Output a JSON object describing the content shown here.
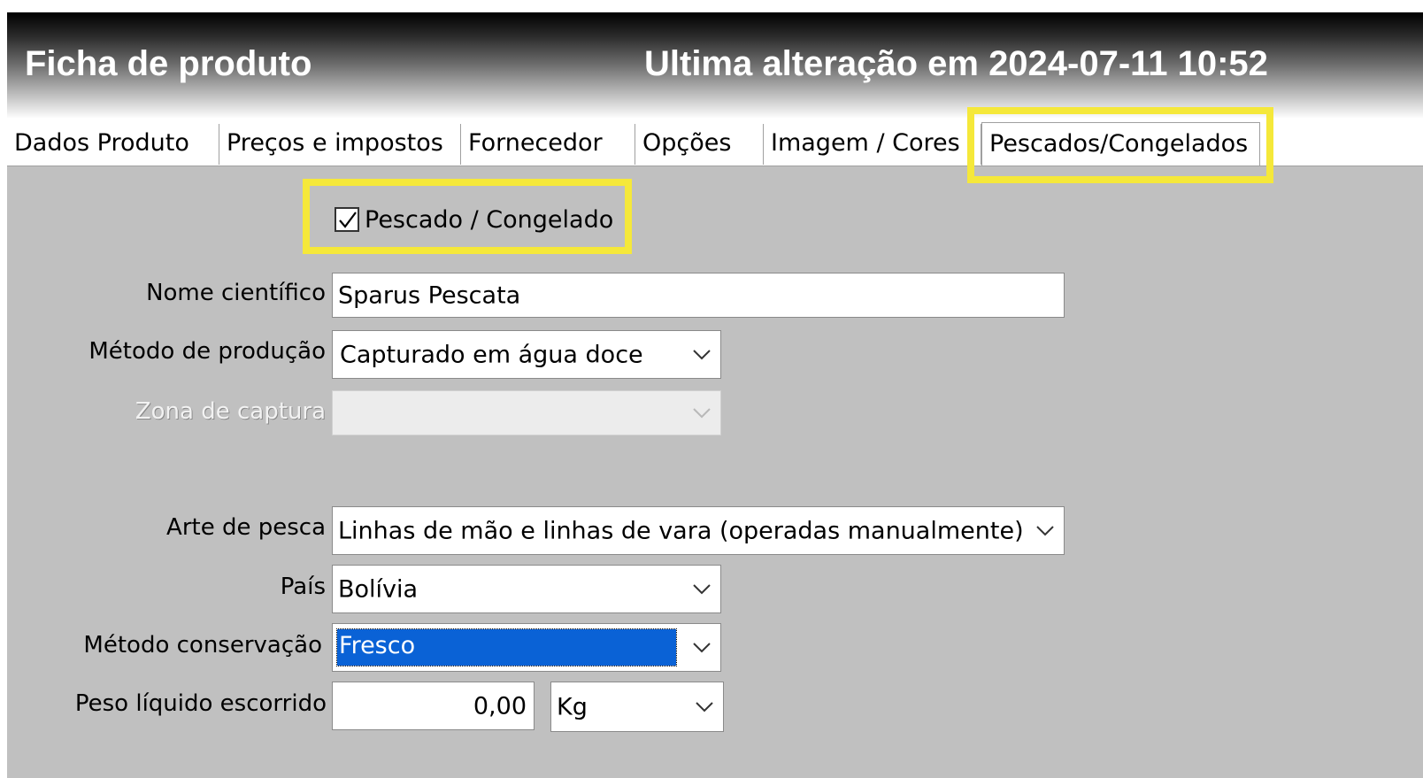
{
  "header": {
    "title": "Ficha de produto",
    "last_modified": "Ultima alteração em 2024-07-11 10:52"
  },
  "tabs": [
    {
      "label": "Dados Produto"
    },
    {
      "label": "Preços e impostos"
    },
    {
      "label": "Fornecedor"
    },
    {
      "label": "Opções"
    },
    {
      "label": "Imagem / Cores"
    },
    {
      "label": "Pescados/Congelados",
      "active": true
    }
  ],
  "form": {
    "pescado_checkbox": {
      "label": "Pescado / Congelado",
      "checked": true
    },
    "nome_cientifico": {
      "label": "Nome científico",
      "value": "Sparus Pescata"
    },
    "metodo_producao": {
      "label": "Método de produção",
      "value": "Capturado em água doce"
    },
    "zona_captura": {
      "label": "Zona de captura",
      "value": "",
      "disabled": true
    },
    "arte_pesca": {
      "label": "Arte de pesca",
      "value": "Linhas de mão e linhas de vara (operadas manualmente)"
    },
    "pais": {
      "label": "País",
      "value": "Bolívia"
    },
    "metodo_conservacao": {
      "label": "Método conservação",
      "value": "Fresco"
    },
    "peso_liquido": {
      "label": "Peso líquido escorrido",
      "value": "0,00",
      "unit": "Kg"
    }
  },
  "colors": {
    "highlight": "#f5e83a",
    "selection": "#0a62d6",
    "panel": "#c0c0c0"
  },
  "icons": {
    "dropdown": "chevron-down-icon",
    "checkbox": "check-icon"
  }
}
